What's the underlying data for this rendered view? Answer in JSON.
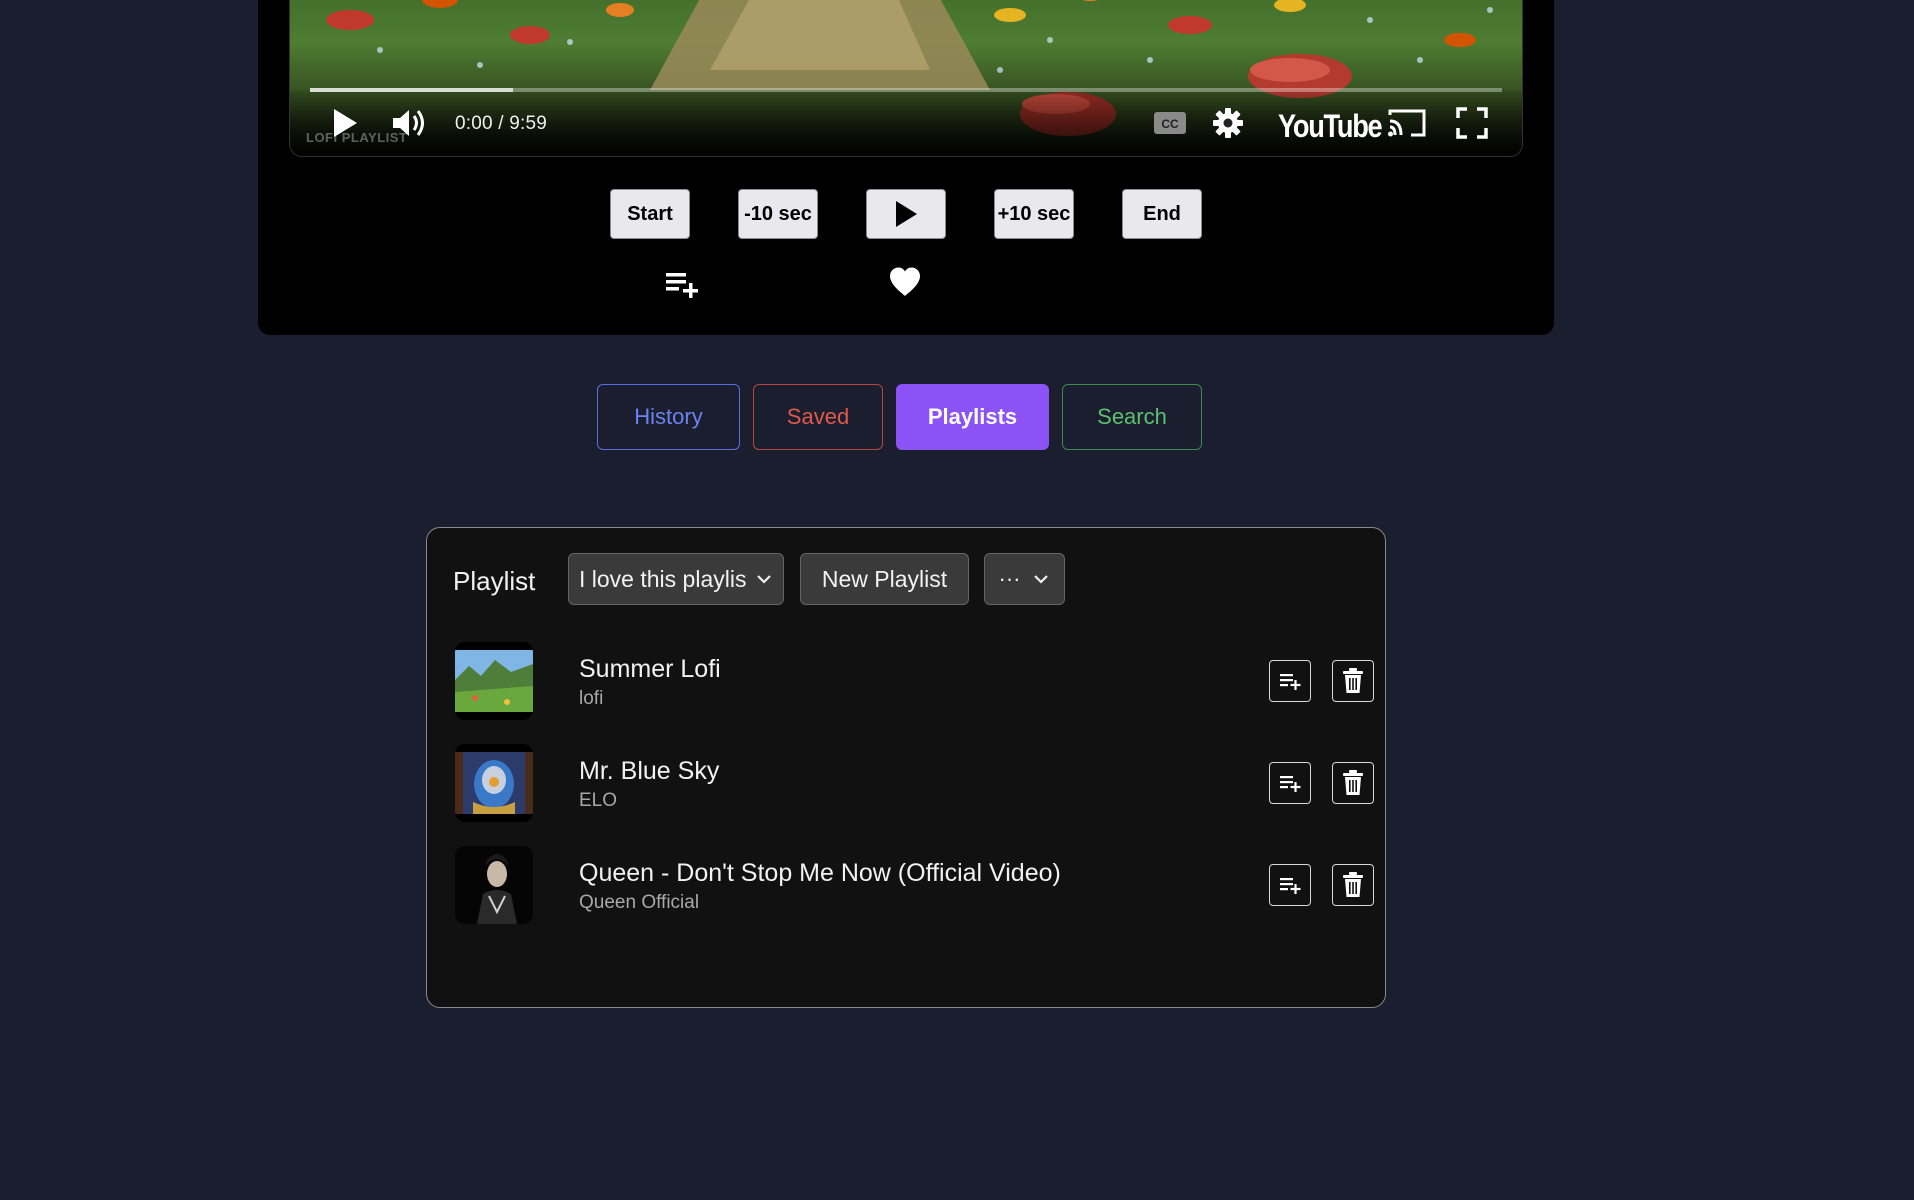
{
  "player": {
    "time_readout": "0:00 / 9:59",
    "progress_fraction": 0.17,
    "channel_watermark": "LOFI PLAYLIST",
    "brand": "YouTube",
    "icons": [
      "play-icon",
      "volume-icon",
      "captions-icon",
      "settings-icon",
      "cast-icon",
      "fullscreen-icon"
    ]
  },
  "controls": {
    "start_label": "Start",
    "back_label": "-10 sec",
    "play_icon": "play-icon",
    "forward_label": "+10 sec",
    "end_label": "End",
    "add_to_queue_icon": "playlist-add-icon",
    "favorite_icon": "heart-icon"
  },
  "tabs": [
    {
      "label": "History",
      "color": "#6b82f0"
    },
    {
      "label": "Saved",
      "color": "#e0594d"
    },
    {
      "label": "Playlists",
      "color": "#8b52f6",
      "active": true
    },
    {
      "label": "Search",
      "color": "#5cc072"
    }
  ],
  "playlist": {
    "label": "Playlist",
    "selected": "I love this playlist",
    "new_playlist_label": "New Playlist",
    "more_label": "···",
    "tracks": [
      {
        "title": "Summer Lofi",
        "artist": "lofi"
      },
      {
        "title": "Mr. Blue Sky",
        "artist": "ELO"
      },
      {
        "title": "Queen - Don't Stop Me Now (Official Video)",
        "artist": "Queen Official"
      }
    ],
    "row_icons": [
      "playlist-add-icon",
      "trash-icon"
    ]
  },
  "colors": {
    "background": "#1b1e2e",
    "panel": "#000000",
    "accent": "#8b52f6"
  }
}
